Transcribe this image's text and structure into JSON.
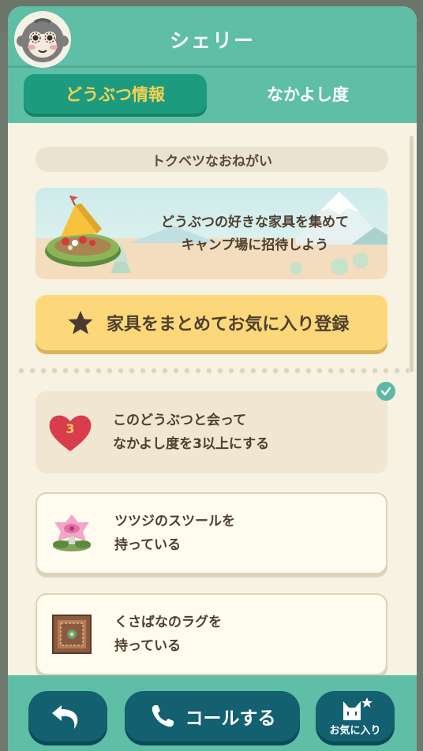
{
  "header": {
    "title": "シェリー",
    "avatar_icon": "monkey-avatar-icon"
  },
  "tabs": [
    {
      "label": "どうぶつ情報",
      "active": true
    },
    {
      "label": "なかよし度",
      "active": false
    }
  ],
  "special_request": {
    "section_label": "トクベツなおねがい",
    "banner_line1": "どうぶつの好きな家具を集めて",
    "banner_line2": "キャンプ場に招待しよう",
    "favorite_button_label": "家具をまとめてお気に入り登録"
  },
  "requirements": [
    {
      "line1": "このどうぶつと会って",
      "line2": "なかよし度を3以上にする",
      "icon": "heart-icon",
      "badge": "3",
      "completed": true
    },
    {
      "line1": "ツツジのスツールを",
      "line2": "持っている",
      "icon": "azalea-stool-icon",
      "completed": false
    },
    {
      "line1": "くさばなのラグを",
      "line2": "持っている",
      "icon": "flower-rug-icon",
      "completed": false
    }
  ],
  "footer": {
    "back_icon": "back-arrow-icon",
    "call_label": "コールする",
    "call_icon": "phone-icon",
    "favorite_label": "お気に入り",
    "favorite_icon": "cat-star-icon"
  },
  "colors": {
    "header_green": "#5fbea6",
    "active_tab": "#1d9b7e",
    "active_tab_text": "#f6d154",
    "cream": "#f7f2e2",
    "button_yellow": "#fcd87a",
    "footer_button": "#136071"
  }
}
